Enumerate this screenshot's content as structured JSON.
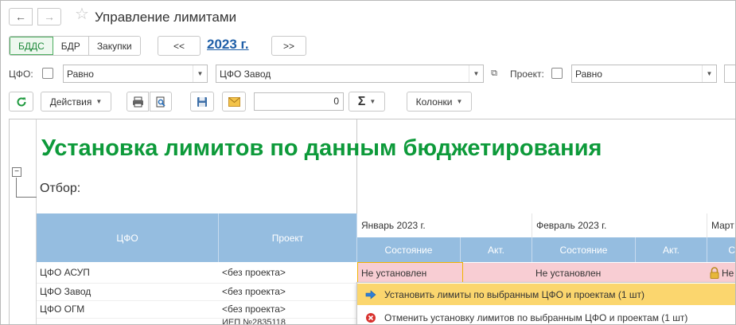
{
  "window": {
    "title": "Управление лимитами"
  },
  "nav": {
    "back": "←",
    "forward": "→",
    "favorite": "☆"
  },
  "modes": [
    {
      "label": "БДДС",
      "active": true
    },
    {
      "label": "БДР",
      "active": false
    },
    {
      "label": "Закупки",
      "active": false
    }
  ],
  "period": {
    "prev": "<<",
    "year": "2023 г.",
    "next": ">>"
  },
  "filters": {
    "cfo_label": "ЦФО:",
    "cfo_condition": "Равно",
    "cfo_value": "ЦФО Завод",
    "project_label": "Проект:",
    "project_condition": "Равно"
  },
  "toolbar": {
    "actions": "Действия",
    "number_value": "0",
    "sum": "Σ",
    "columns": "Колонки"
  },
  "report": {
    "heading": "Установка лимитов по данным бюджетирования",
    "filter_label": "Отбор:",
    "col_cfo": "ЦФО",
    "col_project": "Проект",
    "months": [
      "Январь 2023 г.",
      "Февраль 2023 г.",
      "Март"
    ],
    "sub_state": "Состояние",
    "sub_act": "Акт.",
    "rows": [
      {
        "cfo": "ЦФО АСУП",
        "project": "<без проекта>",
        "jan_state": "Не установлен",
        "feb_state": "Не установлен",
        "mar_state": "Не"
      },
      {
        "cfo": "ЦФО Завод",
        "project": "<без проекта>"
      },
      {
        "cfo": "ЦФО ОГМ",
        "project": "<без проекта>"
      },
      {
        "cfo": "",
        "project": "ИЕП №2835118"
      }
    ]
  },
  "context_menu": {
    "items": [
      {
        "label": "Установить лимиты по выбранным ЦФО и проектам (1 шт)",
        "icon": "arrow-right-icon",
        "highlighted": true
      },
      {
        "label": "Отменить установку лимитов по выбранным ЦФО и проектам (1 шт)",
        "icon": "cancel-icon",
        "highlighted": false
      }
    ]
  },
  "colors": {
    "accent_green": "#0d9a3a",
    "header_blue": "#95bde0",
    "state_pink": "#f8cdd3",
    "menu_highlight": "#fbd66e",
    "link_blue": "#1f5fa8"
  }
}
